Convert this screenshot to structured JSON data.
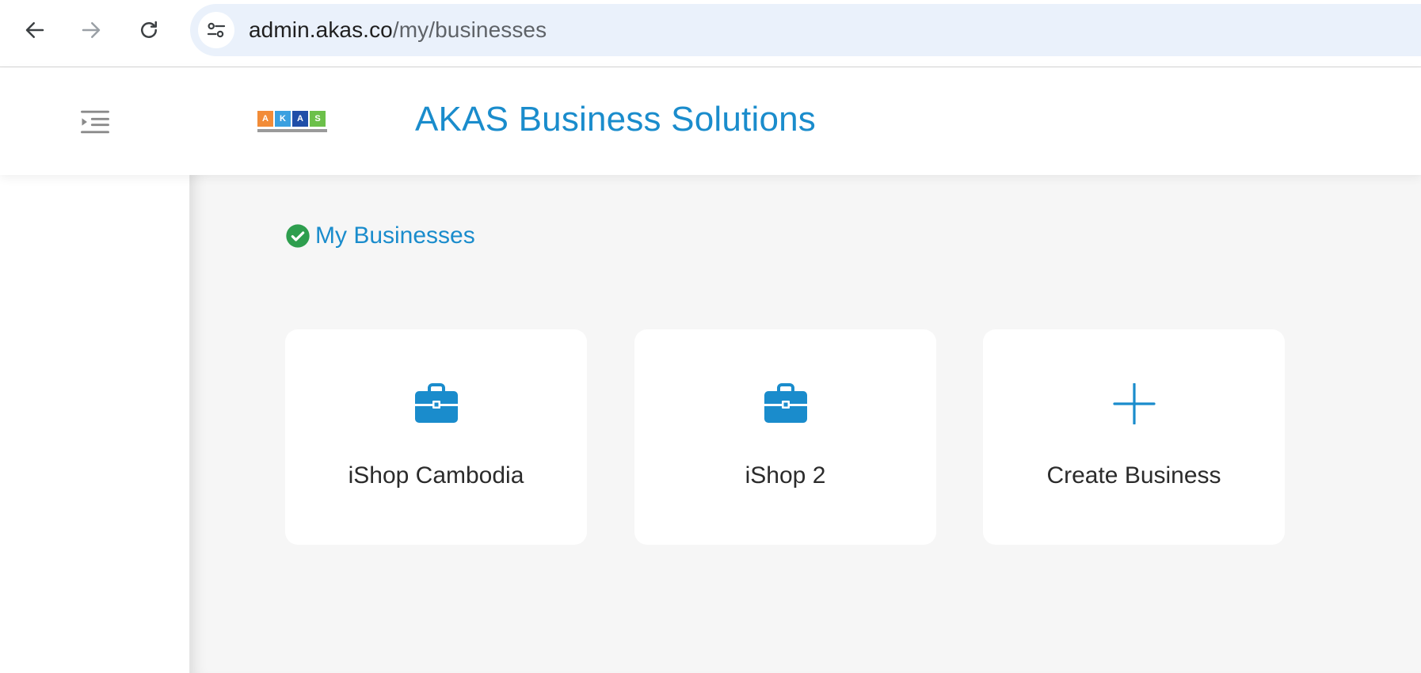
{
  "browser": {
    "url_host": "admin.akas.co",
    "url_path": "/my/businesses"
  },
  "header": {
    "logo_letters": [
      "A",
      "K",
      "A",
      "S"
    ],
    "logo_colors": [
      "#f28c38",
      "#3aa0e0",
      "#1f4ea8",
      "#6cc04a"
    ],
    "title": "AKAS Business Solutions"
  },
  "main": {
    "section_title": "My Businesses",
    "cards": [
      {
        "label": "iShop Cambodia",
        "icon": "briefcase-icon"
      },
      {
        "label": "iShop 2",
        "icon": "briefcase-icon"
      },
      {
        "label": "Create Business",
        "icon": "plus-icon"
      }
    ]
  },
  "colors": {
    "accent": "#1a8ccc",
    "success": "#2e9e4e",
    "content_bg": "#f6f6f6"
  }
}
